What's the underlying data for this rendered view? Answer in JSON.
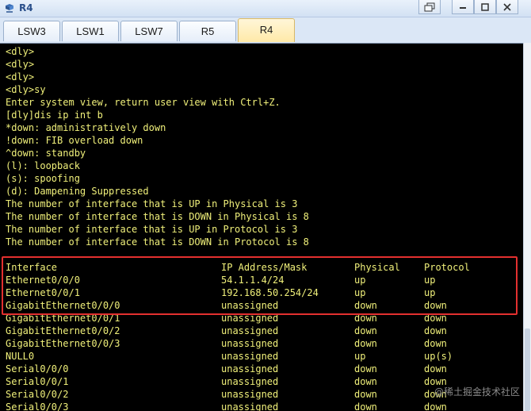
{
  "window": {
    "title": "R4"
  },
  "tabs": [
    {
      "label": "LSW3",
      "active": false
    },
    {
      "label": "LSW1",
      "active": false
    },
    {
      "label": "LSW7",
      "active": false
    },
    {
      "label": "R5",
      "active": false
    },
    {
      "label": "R4",
      "active": true
    }
  ],
  "terminal": {
    "lines": [
      "<dly>",
      "<dly>",
      "<dly>",
      "<dly>sy",
      "Enter system view, return user view with Ctrl+Z.",
      "[dly]dis ip int b",
      "*down: administratively down",
      "!down: FIB overload down",
      "^down: standby",
      "(l): loopback",
      "(s): spoofing",
      "(d): Dampening Suppressed",
      "The number of interface that is UP in Physical is 3",
      "The number of interface that is DOWN in Physical is 8",
      "The number of interface that is UP in Protocol is 3",
      "The number of interface that is DOWN in Protocol is 8"
    ],
    "table": {
      "headers": [
        "Interface",
        "IP Address/Mask",
        "Physical",
        "Protocol"
      ],
      "rows": [
        [
          "Ethernet0/0/0",
          "54.1.1.4/24",
          "up",
          "up"
        ],
        [
          "Ethernet0/0/1",
          "192.168.50.254/24",
          "up",
          "up"
        ],
        [
          "GigabitEthernet0/0/0",
          "unassigned",
          "down",
          "down"
        ],
        [
          "GigabitEthernet0/0/1",
          "unassigned",
          "down",
          "down"
        ],
        [
          "GigabitEthernet0/0/2",
          "unassigned",
          "down",
          "down"
        ],
        [
          "GigabitEthernet0/0/3",
          "unassigned",
          "down",
          "down"
        ],
        [
          "NULL0",
          "unassigned",
          "up",
          "up(s)"
        ],
        [
          "Serial0/0/0",
          "unassigned",
          "down",
          "down"
        ],
        [
          "Serial0/0/1",
          "unassigned",
          "down",
          "down"
        ],
        [
          "Serial0/0/2",
          "unassigned",
          "down",
          "down"
        ],
        [
          "Serial0/0/3",
          "unassigned",
          "down",
          "down"
        ]
      ]
    }
  },
  "watermark": "@稀土掘金技术社区",
  "colors": {
    "terminal_bg": "#000000",
    "terminal_text": "#f0f07a",
    "highlight": "#e3302f",
    "active_tab": "#ffe9a8"
  },
  "icons": [
    "router-icon",
    "restore-icon",
    "minimize-icon",
    "maximize-icon",
    "close-icon"
  ]
}
